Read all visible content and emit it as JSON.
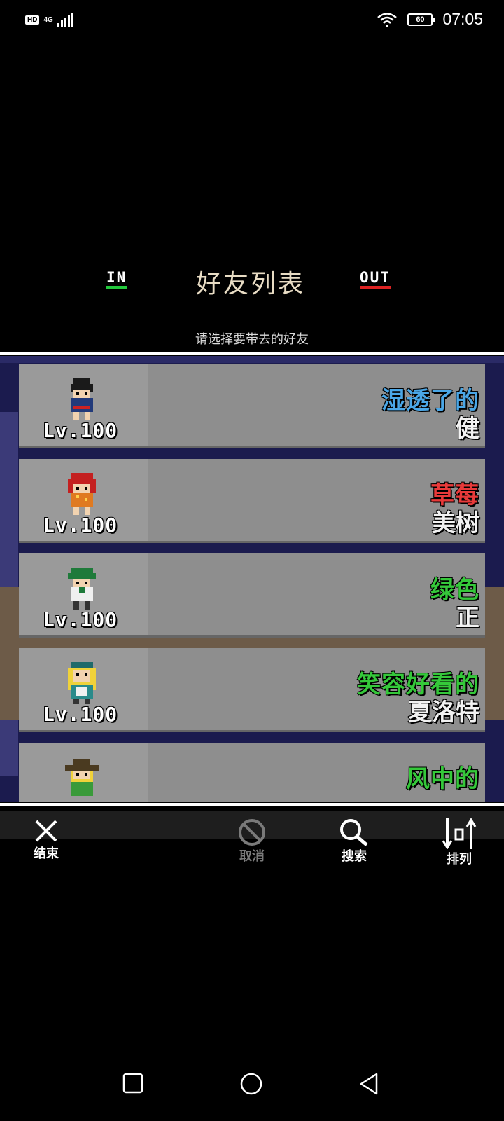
{
  "status_bar": {
    "hd": "HD",
    "network": "4G",
    "battery": "60",
    "time": "07:05"
  },
  "header": {
    "tab_in": "IN",
    "tab_out": "OUT",
    "title": "好友列表",
    "subtitle": "请选择要带去的好友"
  },
  "friends": [
    {
      "level": "Lv.100",
      "epithet": "湿透了的",
      "name": "健",
      "epithet_color": "#4aa6e6"
    },
    {
      "level": "Lv.100",
      "epithet": "草莓",
      "name": "美树",
      "epithet_color": "#e83a3a"
    },
    {
      "level": "Lv.100",
      "epithet": "绿色",
      "name": "正",
      "epithet_color": "#35c83a"
    },
    {
      "level": "Lv.100",
      "epithet": "笑容好看的",
      "name": "夏洛特",
      "epithet_color": "#35c83a"
    },
    {
      "level": "",
      "epithet": "风中的",
      "name": "",
      "epithet_color": "#35c83a"
    }
  ],
  "toolbar": {
    "end": "结束",
    "cancel": "取消",
    "search": "搜索",
    "sort": "排列"
  },
  "colors": {
    "tab_in_underline": "#22c83c",
    "tab_out_underline": "#dd2222",
    "card_bg": "#8e8e8e"
  }
}
